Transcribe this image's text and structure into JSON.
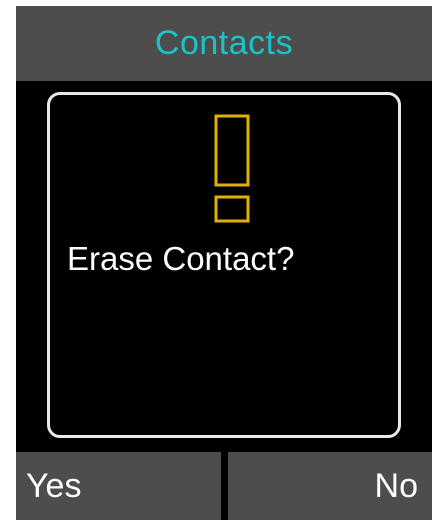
{
  "header": {
    "title": "Contacts"
  },
  "dialog": {
    "icon": "exclamation-icon",
    "message": "Erase Contact?"
  },
  "softkeys": {
    "left_label": "Yes",
    "right_label": "No"
  },
  "colors": {
    "title": "#19c3c8",
    "icon": "#e0b000",
    "bar": "#4d4d4d",
    "dialog_border": "#e9e9e9"
  }
}
